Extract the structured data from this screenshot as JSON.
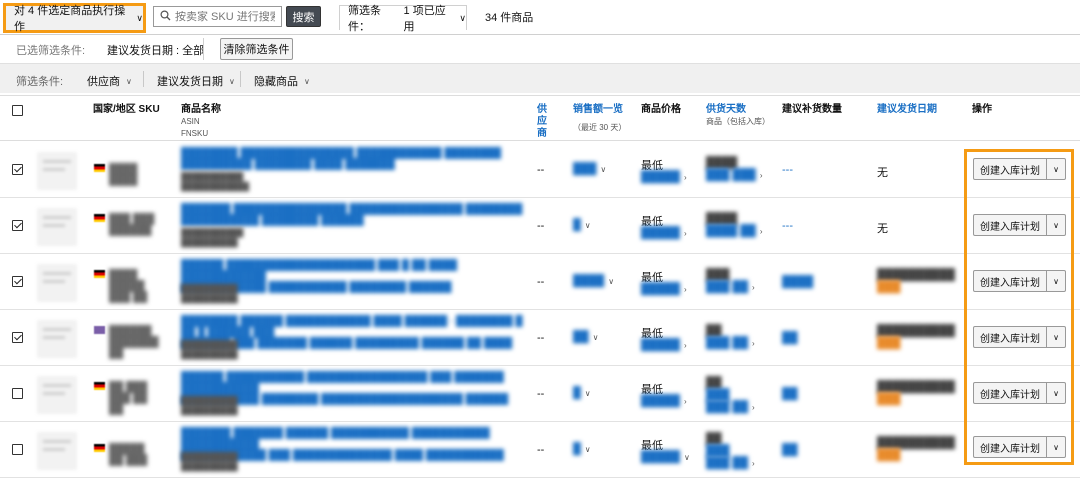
{
  "toolbar": {
    "bulk_action_label": "对 4 件选定商品执行操作",
    "search_placeholder": "按卖家 SKU 进行搜索",
    "search_button": "搜索",
    "filter_status_label": "筛选条件：",
    "filter_status_value": "1 项已应用",
    "product_count": "34 件商品"
  },
  "selected_filters": {
    "label": "已选筛选条件:",
    "value": "建议发货日期 : 全部",
    "clear_button": "清除筛选条件"
  },
  "filter_bar": {
    "label": "筛选条件:",
    "items": [
      "供应商",
      "建议发货日期",
      "隐藏商品"
    ]
  },
  "table": {
    "headers": {
      "country_sku": "国家/地区 SKU",
      "product_name": "商品名称",
      "asin": "ASIN",
      "fnsku": "FNSKU",
      "supplier": "供应商",
      "sales": "销售额一览",
      "sales_sub": "（最近 30 天）",
      "price": "商品价格",
      "supply_days": "供货天数",
      "supply_days_sub": "商品（包括入库）",
      "restock_qty": "建议补货数量",
      "ship_date": "建议发货日期",
      "action": "操作"
    },
    "rows": [
      {
        "checked": true,
        "flag": "de",
        "supplier": "--",
        "price_label": "最低",
        "restock": "---",
        "ship_date": "无",
        "action": "创建入库计划"
      },
      {
        "checked": true,
        "flag": "de",
        "supplier": "--",
        "price_label": "最低",
        "restock": "---",
        "ship_date": "无",
        "action": "创建入库计划"
      },
      {
        "checked": true,
        "flag": "de",
        "supplier": "--",
        "price_label": "最低",
        "restock": "",
        "ship_date": "",
        "action": "创建入库计划"
      },
      {
        "checked": true,
        "flag": "uk",
        "supplier": "--",
        "price_label": "最低",
        "restock": "",
        "ship_date": "",
        "action": "创建入库计划"
      },
      {
        "checked": false,
        "flag": "de",
        "supplier": "--",
        "price_label": "最低",
        "restock": "",
        "ship_date": "",
        "action": "创建入库计划"
      },
      {
        "checked": false,
        "flag": "de",
        "supplier": "--",
        "price_label": "最低",
        "restock": "",
        "ship_date": "",
        "action": "创建入库计划"
      }
    ]
  },
  "colors": {
    "highlight": "#f59b14",
    "link": "#1a6fc4",
    "search_button_bg": "#444a52"
  }
}
